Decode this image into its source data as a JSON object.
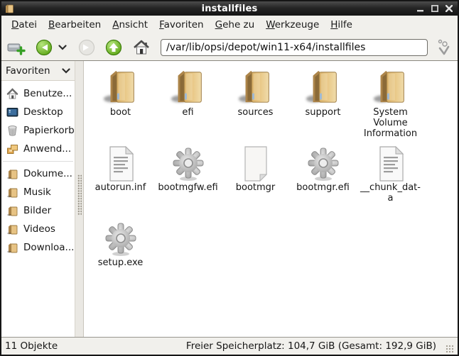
{
  "window": {
    "title": "installfiles",
    "controls": [
      "minimize",
      "maximize",
      "close"
    ]
  },
  "menubar": {
    "items": [
      {
        "label": "Datei"
      },
      {
        "label": "Bearbeiten"
      },
      {
        "label": "Ansicht"
      },
      {
        "label": "Favoriten"
      },
      {
        "label": "Gehe zu"
      },
      {
        "label": "Werkzeuge"
      },
      {
        "label": "Hilfe"
      }
    ]
  },
  "toolbar": {
    "path": "/var/lib/opsi/depot/win11-x64/installfiles",
    "buttons": [
      {
        "name": "new-tab-button",
        "icon": "new-tab-icon",
        "enabled": true
      },
      {
        "name": "back-button",
        "icon": "back-arrow-icon",
        "enabled": true
      },
      {
        "name": "history-dropdown",
        "icon": "chevron-down-icon",
        "enabled": true
      },
      {
        "name": "forward-button",
        "icon": "forward-arrow-icon",
        "enabled": false
      },
      {
        "name": "up-button",
        "icon": "up-arrow-icon",
        "enabled": true
      },
      {
        "name": "home-button",
        "icon": "home-icon",
        "enabled": true
      },
      {
        "name": "view-mode-button",
        "icon": "bubbles-icon",
        "enabled": true
      }
    ]
  },
  "sidebar": {
    "header": "Favoriten",
    "places": [
      {
        "label": "Benutze...",
        "icon": "home-icon"
      },
      {
        "label": "Desktop",
        "icon": "desktop-icon"
      },
      {
        "label": "Papierkorb",
        "icon": "trash-icon"
      },
      {
        "label": "Anwend...",
        "icon": "applications-icon"
      }
    ],
    "bookmarks": [
      {
        "label": "Dokume...",
        "icon": "folder-icon"
      },
      {
        "label": "Musik",
        "icon": "folder-icon"
      },
      {
        "label": "Bilder",
        "icon": "folder-icon"
      },
      {
        "label": "Videos",
        "icon": "folder-icon"
      },
      {
        "label": "Downloa...",
        "icon": "folder-icon"
      }
    ]
  },
  "files": {
    "items": [
      {
        "name": "boot",
        "display": "boot",
        "icon": "folder"
      },
      {
        "name": "efi",
        "display": "efi",
        "icon": "folder"
      },
      {
        "name": "sources",
        "display": "sources",
        "icon": "folder"
      },
      {
        "name": "support",
        "display": "support",
        "icon": "folder"
      },
      {
        "name": "System Volume Information",
        "display": "System\nVolume\nInformation",
        "icon": "folder"
      },
      {
        "name": "autorun.inf",
        "display": "autorun.inf",
        "icon": "text-file"
      },
      {
        "name": "bootmgfw.efi",
        "display": "bootmgfw.efi",
        "icon": "gear"
      },
      {
        "name": "bootmgr",
        "display": "bootmgr",
        "icon": "plain-file"
      },
      {
        "name": "bootmgr.efi",
        "display": "bootmgr.efi",
        "icon": "gear"
      },
      {
        "name": "__chunk_data",
        "display": "__chunk_dat-\na",
        "icon": "text-file"
      },
      {
        "name": "setup.exe",
        "display": "setup.exe",
        "icon": "gear"
      }
    ]
  },
  "statusbar": {
    "left": "11 Objekte",
    "right": "Freier Speicherplatz: 104,7 GiB (Gesamt: 192,9 GiB)"
  },
  "colors": {
    "titlebar": "#262626",
    "chrome": "#f1f0ec",
    "accent_green": "#5aa70f",
    "folder_tan": "#e3bd7a",
    "content_bg": "#ffffff"
  }
}
